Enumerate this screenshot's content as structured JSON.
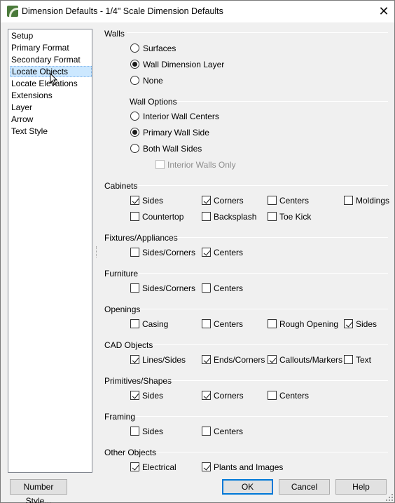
{
  "window": {
    "title": "Dimension Defaults - 1/4\" Scale Dimension Defaults",
    "icon": "chief-architect-app-icon",
    "close_glyph": "✕"
  },
  "sidebar": {
    "items": [
      {
        "label": "Setup"
      },
      {
        "label": "Primary Format"
      },
      {
        "label": "Secondary Format"
      },
      {
        "label": "Locate Objects",
        "selected": true
      },
      {
        "label": "Locate Elevations"
      },
      {
        "label": "Extensions"
      },
      {
        "label": "Layer"
      },
      {
        "label": "Arrow"
      },
      {
        "label": "Text Style"
      }
    ]
  },
  "walls": {
    "title": "Walls",
    "options": [
      "Surfaces",
      "Wall Dimension Layer",
      "None"
    ],
    "selected": "Wall Dimension Layer",
    "wall_options": {
      "title": "Wall Options",
      "options": [
        "Interior Wall Centers",
        "Primary Wall Side",
        "Both Wall Sides"
      ],
      "selected": "Primary Wall Side",
      "interior_only": {
        "label": "Interior Walls Only",
        "checked": false,
        "disabled": true
      }
    }
  },
  "cabinets": {
    "title": "Cabinets",
    "items": [
      {
        "label": "Sides",
        "checked": true
      },
      {
        "label": "Corners",
        "checked": true
      },
      {
        "label": "Centers",
        "checked": false
      },
      {
        "label": "Moldings",
        "checked": false
      },
      {
        "label": "Countertop",
        "checked": false
      },
      {
        "label": "Backsplash",
        "checked": false
      },
      {
        "label": "Toe Kick",
        "checked": false
      }
    ]
  },
  "fixtures": {
    "title": "Fixtures/Appliances",
    "items": [
      {
        "label": "Sides/Corners",
        "checked": false
      },
      {
        "label": "Centers",
        "checked": true
      }
    ]
  },
  "furniture": {
    "title": "Furniture",
    "items": [
      {
        "label": "Sides/Corners",
        "checked": false
      },
      {
        "label": "Centers",
        "checked": false
      }
    ]
  },
  "openings": {
    "title": "Openings",
    "items": [
      {
        "label": "Casing",
        "checked": false
      },
      {
        "label": "Centers",
        "checked": false
      },
      {
        "label": "Rough Opening",
        "checked": false
      },
      {
        "label": "Sides",
        "checked": true
      }
    ]
  },
  "cad_objects": {
    "title": "CAD Objects",
    "items": [
      {
        "label": "Lines/Sides",
        "checked": true
      },
      {
        "label": "Ends/Corners",
        "checked": true
      },
      {
        "label": "Callouts/Markers",
        "checked": true
      },
      {
        "label": "Text",
        "checked": false
      }
    ]
  },
  "primitives": {
    "title": "Primitives/Shapes",
    "items": [
      {
        "label": "Sides",
        "checked": true
      },
      {
        "label": "Corners",
        "checked": true
      },
      {
        "label": "Centers",
        "checked": false
      }
    ]
  },
  "framing": {
    "title": "Framing",
    "items": [
      {
        "label": "Sides",
        "checked": false
      },
      {
        "label": "Centers",
        "checked": false
      }
    ]
  },
  "other_objects": {
    "title": "Other Objects",
    "items": [
      {
        "label": "Electrical",
        "checked": true
      },
      {
        "label": "Plants and Images",
        "checked": true
      }
    ]
  },
  "buttons": {
    "number_style": "Number Style...",
    "ok": "OK",
    "cancel": "Cancel",
    "help": "Help"
  },
  "colors": {
    "selection_bg": "#cce8ff",
    "default_button_border": "#0078d7"
  }
}
